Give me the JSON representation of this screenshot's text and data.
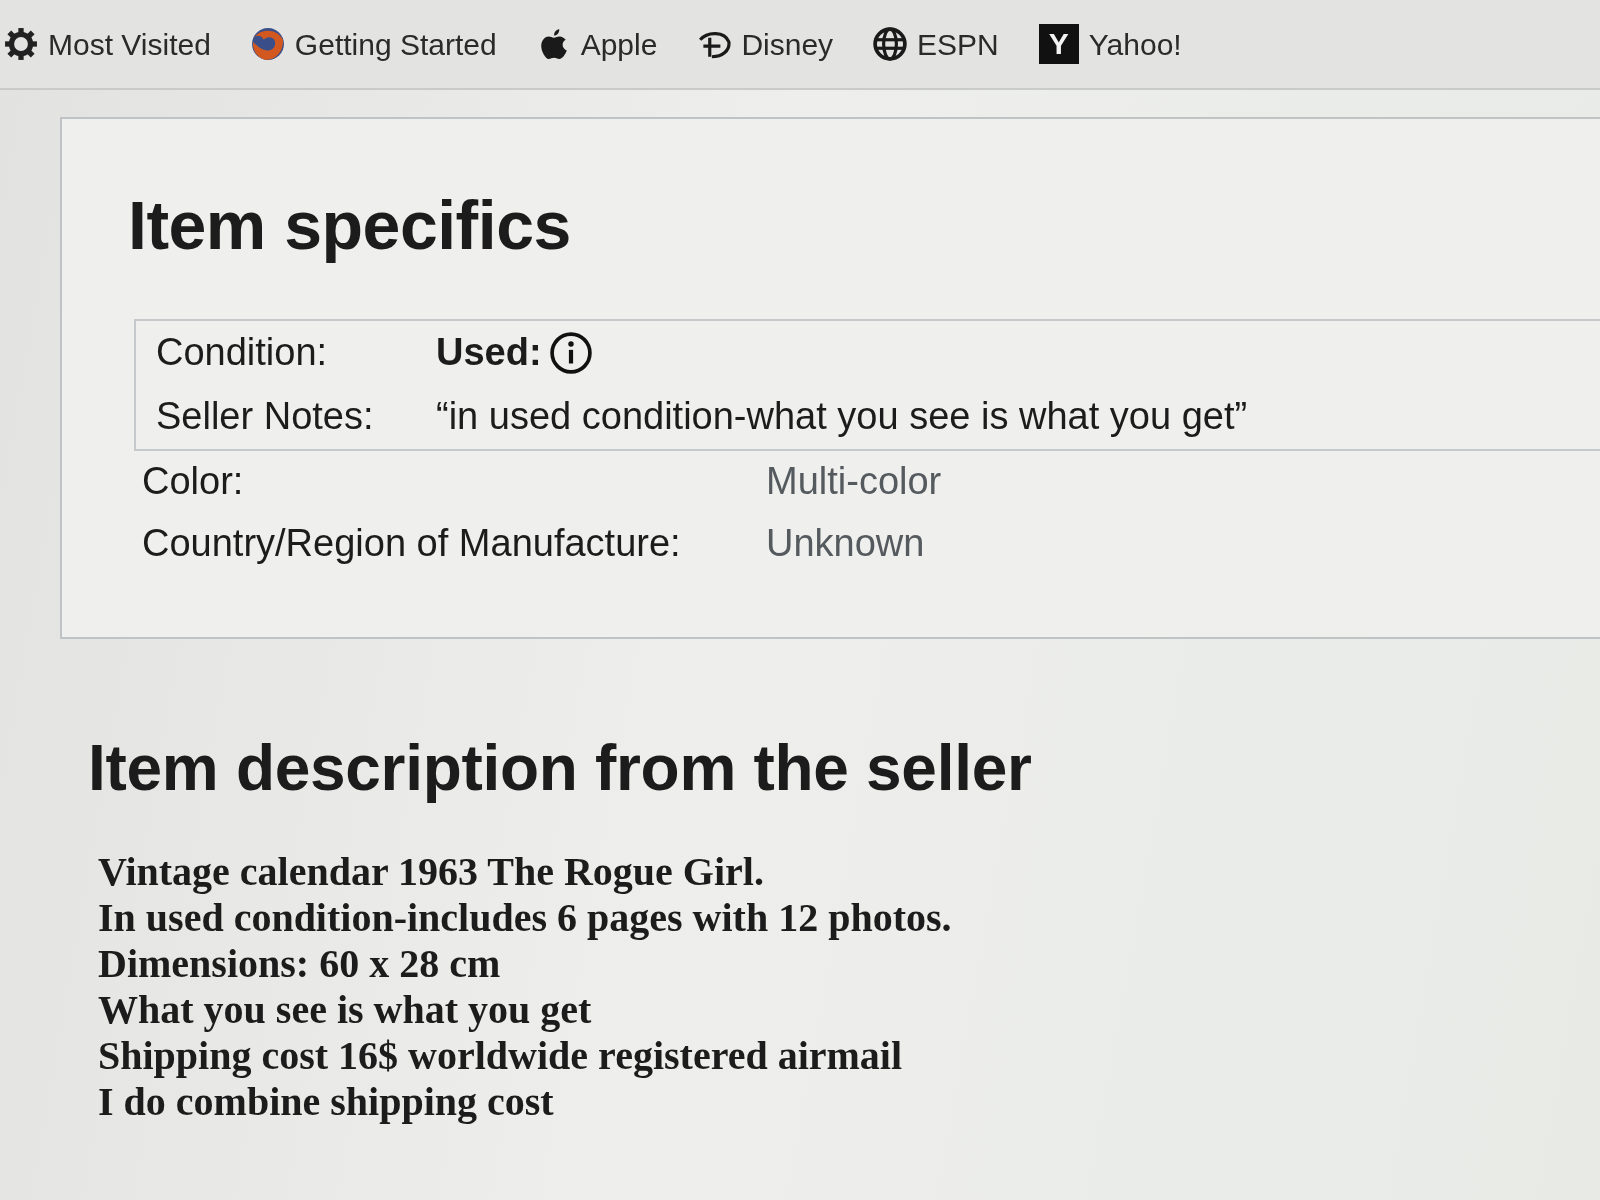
{
  "bookmarks_bar": {
    "items": [
      {
        "label": "Most Visited",
        "kind": "gear"
      },
      {
        "label": "Getting Started",
        "kind": "browser"
      },
      {
        "label": "Apple",
        "kind": "apple"
      },
      {
        "label": "Disney",
        "kind": "swirl"
      },
      {
        "label": "ESPN",
        "kind": "globe"
      },
      {
        "label": "Yahoo!",
        "kind": "tile",
        "icon_text": "Y"
      }
    ]
  },
  "item_specifics": {
    "title": "Item specifics",
    "condition": [
      {
        "label": "Condition:",
        "value": "Used:"
      },
      {
        "label": "Seller Notes:",
        "value": "“in used condition-what you see is what you get”"
      }
    ],
    "rows": [
      {
        "label": "Color:",
        "value": "Multi-color"
      },
      {
        "label": "Country/Region of Manufacture:",
        "value": "Unknown"
      }
    ]
  },
  "item_description": {
    "title": "Item description from the seller",
    "lines": [
      "Vintage calendar 1963 The Rogue Girl.",
      "In used condition-includes 6 pages with 12 photos.",
      "Dimensions: 60 x 28 cm",
      "What you see is what you get",
      "Shipping cost 16$ worldwide registered airmail",
      "I do combine shipping cost"
    ]
  }
}
